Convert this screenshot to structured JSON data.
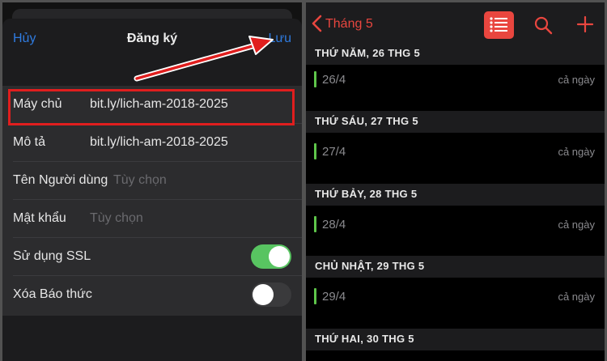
{
  "left": {
    "cancel_label": "Hủy",
    "title": "Đăng ký",
    "save_label": "Lưu",
    "rows": [
      {
        "label": "Máy chủ",
        "value": "bit.ly/lich-am-2018-2025"
      },
      {
        "label": "Mô tả",
        "value": "bit.ly/lich-am-2018-2025"
      },
      {
        "label": "Tên Người dùng",
        "placeholder": "Tùy chọn"
      },
      {
        "label": "Mật khẩu",
        "placeholder": "Tùy chọn"
      },
      {
        "label": "Sử dụng SSL",
        "toggle": "on"
      },
      {
        "label": "Xóa Báo thức",
        "toggle": "off"
      }
    ],
    "colors": {
      "accent": "#2f7be0",
      "highlight": "#e01e1e",
      "toggle_on": "#58c461"
    }
  },
  "right": {
    "month_label": "Tháng 5",
    "icons": [
      "chevron-left-icon",
      "list-icon",
      "search-icon",
      "plus-icon"
    ],
    "days": [
      {
        "header": "THỨ NĂM, 26 THG 5",
        "event": "26/4",
        "duration": "cả ngày"
      },
      {
        "header": "THỨ SÁU, 27 THG 5",
        "event": "27/4",
        "duration": "cả ngày"
      },
      {
        "header": "THỨ BẢY, 28 THG 5",
        "event": "28/4",
        "duration": "cả ngày"
      },
      {
        "header": "CHỦ NHẬT, 29 THG 5",
        "event": "29/4",
        "duration": "cả ngày"
      },
      {
        "header": "THỨ HAI, 30 THG 5"
      }
    ],
    "colors": {
      "accent": "#e9463f",
      "event_bar": "#5ec54a"
    }
  }
}
